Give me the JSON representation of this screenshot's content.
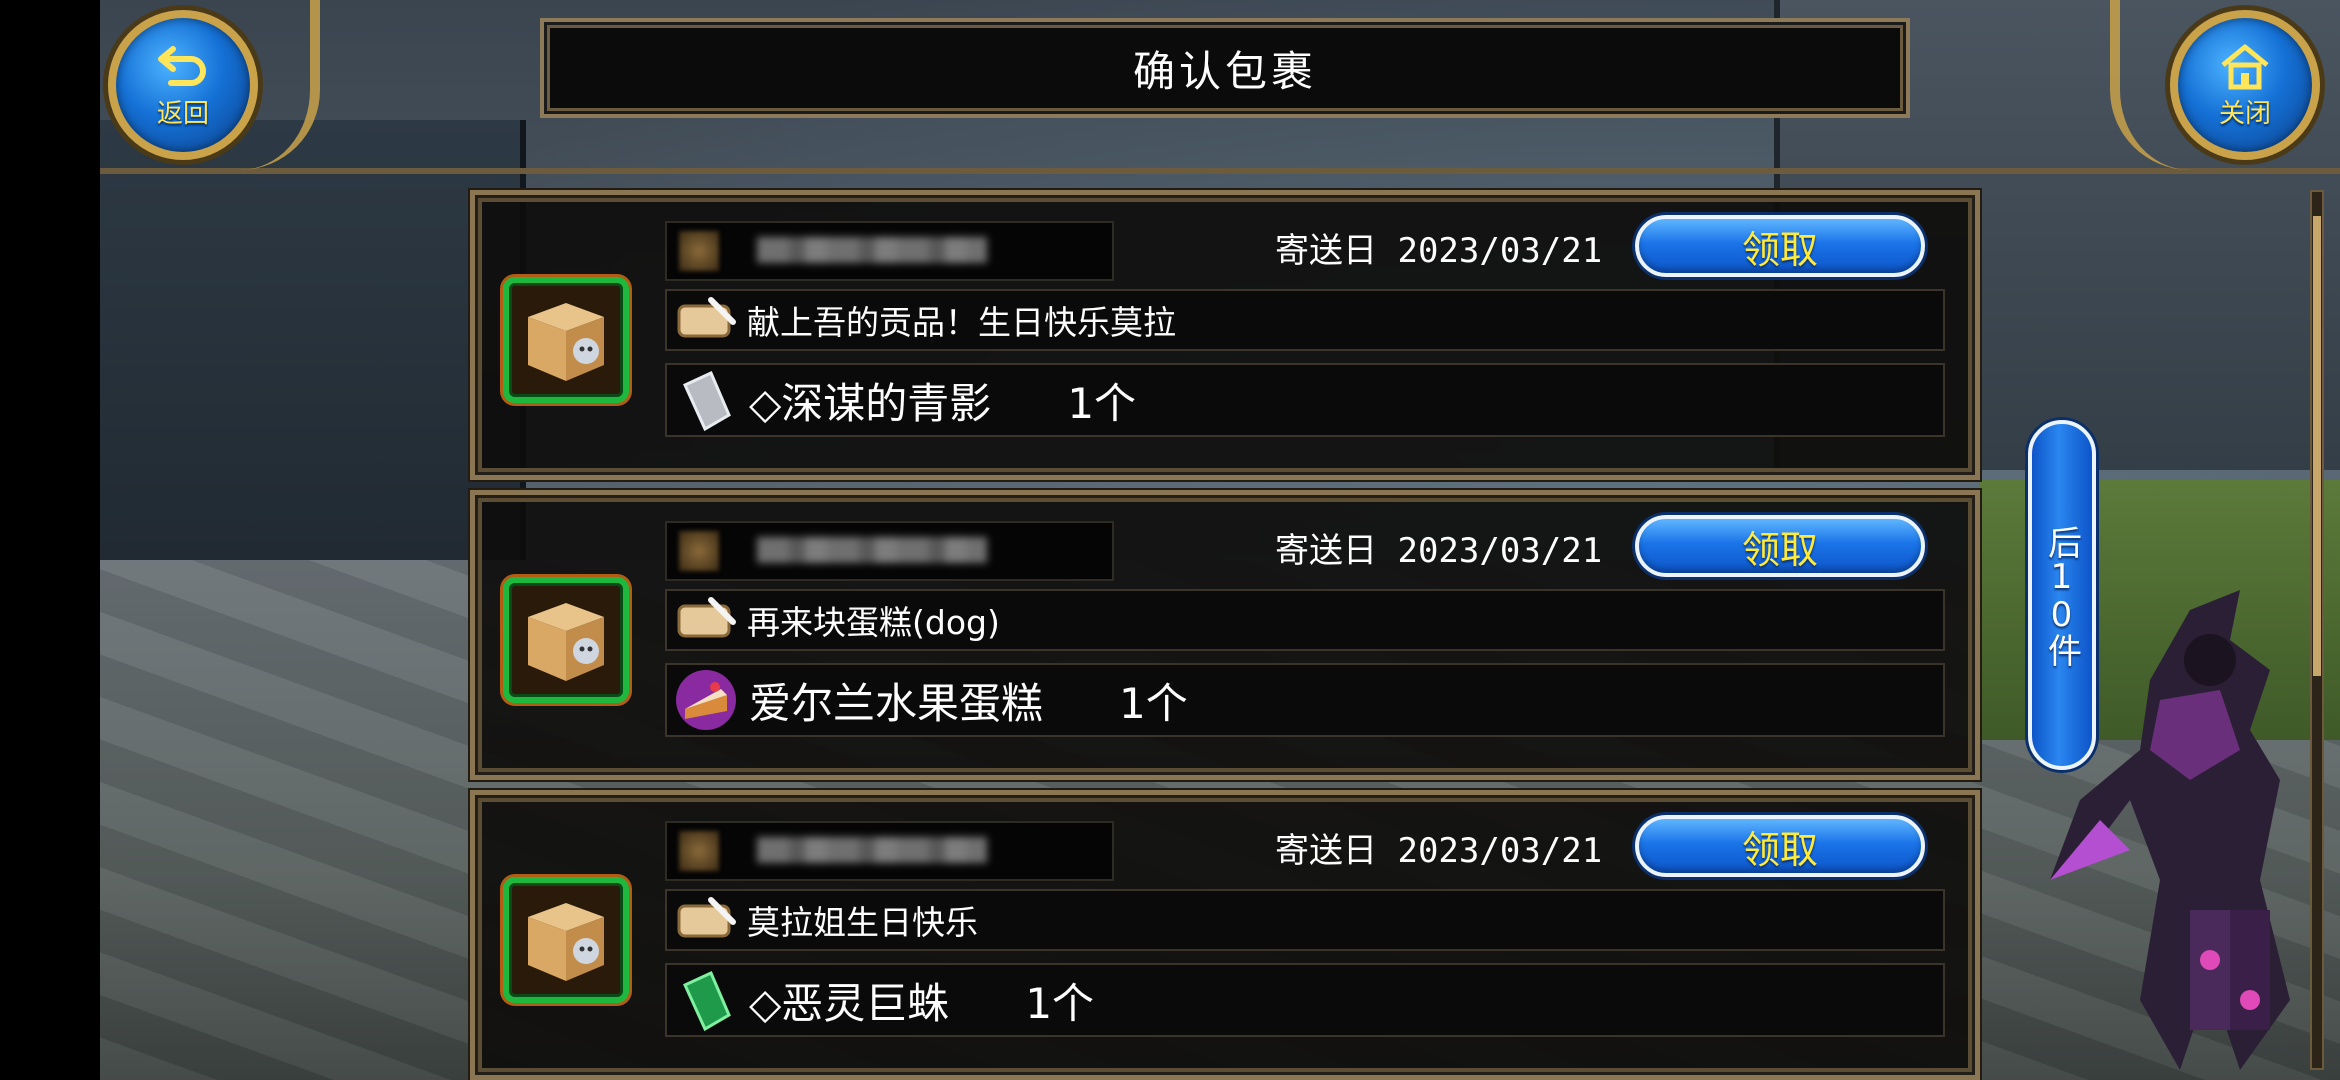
{
  "header": {
    "title": "确认包裹",
    "back_label": "返回",
    "close_label": "关闭"
  },
  "parcels": [
    {
      "date_prefix": "寄送日",
      "date": "2023/03/21",
      "claim_label": "领取",
      "message": "献上吾的贡品！生日快乐莫拉",
      "item_name": "◇深谋的青影",
      "item_qty": "1个",
      "item_icon": "grey-shard-icon"
    },
    {
      "date_prefix": "寄送日",
      "date": "2023/03/21",
      "claim_label": "领取",
      "message": "再来块蛋糕(dog)",
      "item_name": "爱尔兰水果蛋糕",
      "item_qty": "1个",
      "item_icon": "cake-icon"
    },
    {
      "date_prefix": "寄送日",
      "date": "2023/03/21",
      "claim_label": "领取",
      "message": "莫拉姐生日快乐",
      "item_name": "◇恶灵巨蛛",
      "item_qty": "1个",
      "item_icon": "green-shard-icon"
    }
  ],
  "pager": {
    "next_label": "后10件"
  },
  "colors": {
    "accent_blue": "#1a74e8",
    "button_text_yellow": "#ffea3a",
    "frame_gold": "#8a7652",
    "icon_border_green": "#1fb83f"
  }
}
